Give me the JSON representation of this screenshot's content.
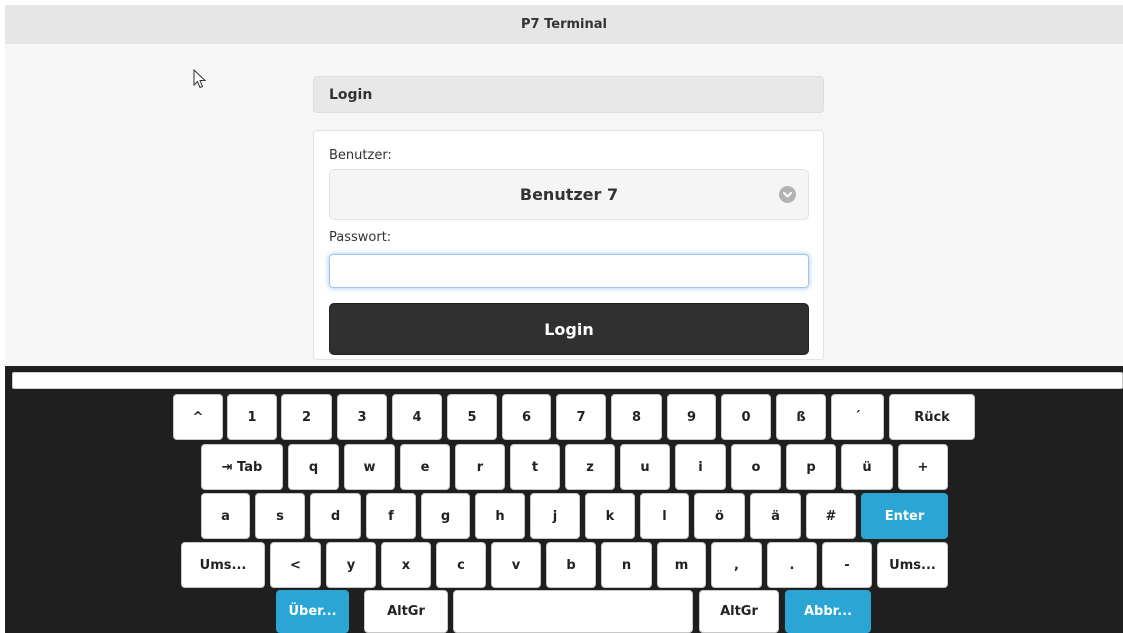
{
  "window": {
    "title": "P7 Terminal"
  },
  "login": {
    "header": "Login",
    "user_label": "Benutzer:",
    "user_value": "Benutzer 7",
    "password_label": "Passwort:",
    "password_value": "",
    "button_label": "Login"
  },
  "keyboard": {
    "input_value": "",
    "rows": [
      [
        {
          "label": "^",
          "name": "key-caret"
        },
        {
          "label": "1",
          "name": "key-1"
        },
        {
          "label": "2",
          "name": "key-2"
        },
        {
          "label": "3",
          "name": "key-3"
        },
        {
          "label": "4",
          "name": "key-4"
        },
        {
          "label": "5",
          "name": "key-5"
        },
        {
          "label": "6",
          "name": "key-6"
        },
        {
          "label": "7",
          "name": "key-7"
        },
        {
          "label": "8",
          "name": "key-8"
        },
        {
          "label": "9",
          "name": "key-9"
        },
        {
          "label": "0",
          "name": "key-0"
        },
        {
          "label": "ß",
          "name": "key-eszett"
        },
        {
          "label": "´",
          "name": "key-acute"
        },
        {
          "label": "Rück",
          "name": "key-backspace"
        }
      ],
      [
        {
          "label": "⇥ Tab",
          "name": "key-tab"
        },
        {
          "label": "q",
          "name": "key-q"
        },
        {
          "label": "w",
          "name": "key-w"
        },
        {
          "label": "e",
          "name": "key-e"
        },
        {
          "label": "r",
          "name": "key-r"
        },
        {
          "label": "t",
          "name": "key-t"
        },
        {
          "label": "z",
          "name": "key-z"
        },
        {
          "label": "u",
          "name": "key-u"
        },
        {
          "label": "i",
          "name": "key-i"
        },
        {
          "label": "o",
          "name": "key-o"
        },
        {
          "label": "p",
          "name": "key-p"
        },
        {
          "label": "ü",
          "name": "key-ue"
        },
        {
          "label": "+",
          "name": "key-plus"
        }
      ],
      [
        {
          "label": "a",
          "name": "key-a"
        },
        {
          "label": "s",
          "name": "key-s"
        },
        {
          "label": "d",
          "name": "key-d"
        },
        {
          "label": "f",
          "name": "key-f"
        },
        {
          "label": "g",
          "name": "key-g"
        },
        {
          "label": "h",
          "name": "key-h"
        },
        {
          "label": "j",
          "name": "key-j"
        },
        {
          "label": "k",
          "name": "key-k"
        },
        {
          "label": "l",
          "name": "key-l"
        },
        {
          "label": "ö",
          "name": "key-oe"
        },
        {
          "label": "ä",
          "name": "key-ae"
        },
        {
          "label": "#",
          "name": "key-hash"
        },
        {
          "label": "Enter",
          "name": "key-enter"
        }
      ],
      [
        {
          "label": "Ums...",
          "name": "key-shift-left"
        },
        {
          "label": "<",
          "name": "key-less-than"
        },
        {
          "label": "y",
          "name": "key-y"
        },
        {
          "label": "x",
          "name": "key-x"
        },
        {
          "label": "c",
          "name": "key-c"
        },
        {
          "label": "v",
          "name": "key-v"
        },
        {
          "label": "b",
          "name": "key-b"
        },
        {
          "label": "n",
          "name": "key-n"
        },
        {
          "label": "m",
          "name": "key-m"
        },
        {
          "label": ",",
          "name": "key-comma"
        },
        {
          "label": ".",
          "name": "key-period"
        },
        {
          "label": "-",
          "name": "key-minus"
        },
        {
          "label": "Ums...",
          "name": "key-shift-right"
        }
      ],
      [
        {
          "label": "Über...",
          "name": "key-accept"
        },
        {
          "label": "AltGr",
          "name": "key-altgr-left"
        },
        {
          "label": "",
          "name": "key-space"
        },
        {
          "label": "AltGr",
          "name": "key-altgr-right"
        },
        {
          "label": "Abbr...",
          "name": "key-cancel"
        }
      ]
    ]
  },
  "colors": {
    "accent": "#2aa5d4",
    "button_dark": "#303030",
    "keyboard_bg": "#1f1f1f"
  }
}
